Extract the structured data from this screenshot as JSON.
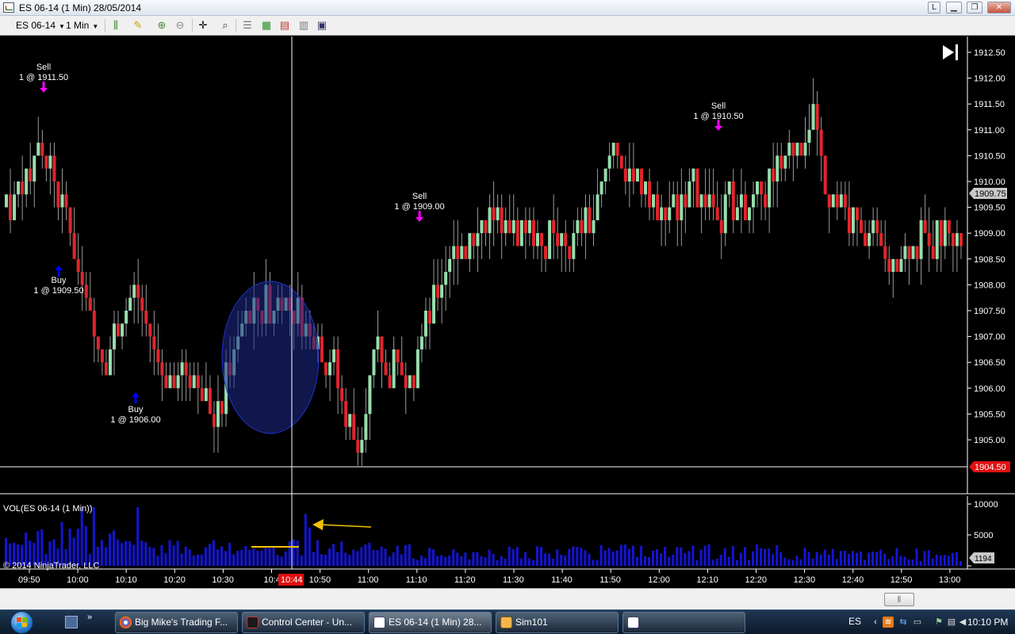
{
  "window": {
    "title": "ES 06-14 (1 Min)  28/05/2014",
    "btn_l": "L"
  },
  "toolbar": {
    "instrument": "ES 06-14",
    "interval": "1 Min",
    "icons": [
      "bar-type-icon",
      "drawing-pencil-icon",
      "zoom-in-icon",
      "zoom-out-icon",
      "crosshair-icon",
      "find-icon",
      "properties-icon",
      "indicators-icon",
      "strategies-icon",
      "chart-templates-icon",
      "data-box-icon"
    ]
  },
  "chart": {
    "price_labels": [
      "1912.50",
      "1912.00",
      "1911.50",
      "1911.00",
      "1910.50",
      "1910.00",
      "1909.50",
      "1909.00",
      "1908.50",
      "1908.00",
      "1907.50",
      "1907.00",
      "1906.50",
      "1906.00",
      "1905.50",
      "1905.00"
    ],
    "last_price_badge": "1909.75",
    "cursor_price_badge": "1904.50",
    "volume_panel_title": "VOL(ES 06-14 (1 Min))",
    "volume_axis_labels": [
      "10000",
      "5000",
      "0"
    ],
    "volume_badge": "1194",
    "copyright": "© 2014 NinjaTrader, LLC",
    "time_labels": [
      "09:50",
      "10:00",
      "10:10",
      "10:20",
      "10:30",
      "10:40",
      "10:50",
      "11:00",
      "11:10",
      "11:20",
      "11:30",
      "11:40",
      "11:50",
      "12:00",
      "12:10",
      "12:20",
      "12:30",
      "12:40",
      "12:50",
      "13:00"
    ],
    "cursor_time_badge": "10:44",
    "trades": [
      {
        "side": "Sell",
        "detail": "1 @ 1911.50"
      },
      {
        "side": "Buy",
        "detail": "1 @ 1909.50"
      },
      {
        "side": "Buy",
        "detail": "1 @ 1906.00"
      },
      {
        "side": "Sell",
        "detail": "1 @ 1909.00"
      },
      {
        "side": "Sell",
        "detail": "1 @ 1910.50"
      }
    ],
    "colors": {
      "up_candle": "#98ddae",
      "down_candle": "#e2252b",
      "volume": "#1414d6",
      "sell_marker": "#ff00ff",
      "buy_marker": "#0000ff",
      "ellipse": "#1c2a8a",
      "annotation": "#f2c200"
    }
  },
  "scrollbar": {
    "thumb": "⫼"
  },
  "taskbar": {
    "buttons": [
      {
        "label": "Big Mike's Trading F..."
      },
      {
        "label": "Control Center - Un..."
      },
      {
        "label": "ES 06-14 (1 Min)  28..."
      },
      {
        "label": "Sim101"
      },
      {
        "label": ""
      }
    ],
    "lang": "ES",
    "clock": "10:10 PM"
  }
}
